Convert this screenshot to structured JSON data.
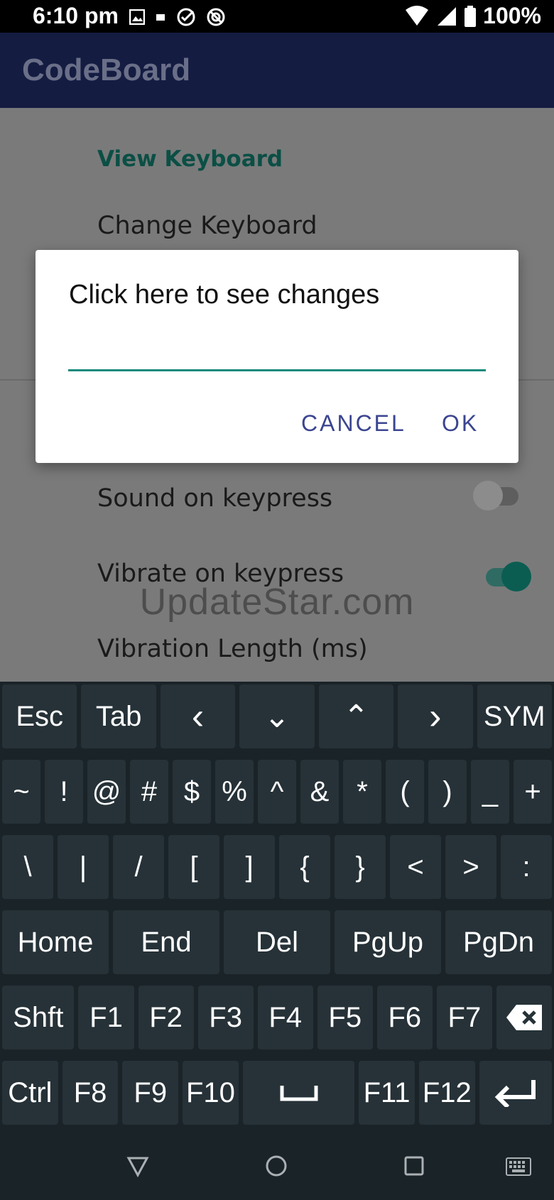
{
  "status_bar": {
    "time": "6:10 pm",
    "battery": "100%",
    "icons_left": [
      "image-icon",
      "notification-icon",
      "check-circle-icon",
      "blocked-icon"
    ],
    "icons_right": [
      "wifi-icon",
      "signal-icon",
      "battery-icon"
    ]
  },
  "app_bar": {
    "title": "CodeBoard"
  },
  "preferences": {
    "category": "View Keyboard",
    "change_keyboard": "Change Keyboard",
    "sound_on_keypress": "Sound on keypress",
    "vibrate_on_keypress": "Vibrate on keypress",
    "vibration_length": "Vibration Length (ms)",
    "sound_enabled": false,
    "vibrate_enabled": true
  },
  "watermark": "UpdateStar.com",
  "dialog": {
    "title": "Click here to see changes",
    "input_value": "",
    "cancel_label": "CANCEL",
    "ok_label": "OK"
  },
  "keyboard": {
    "rows": [
      [
        "Esc",
        "Tab",
        "‹",
        "⌄",
        "⌃",
        "›",
        "SYM"
      ],
      [
        "~",
        "!",
        "@",
        "#",
        "$",
        "%",
        "^",
        "&",
        "*",
        "(",
        ")",
        "_",
        "+"
      ],
      [
        "\\",
        "|",
        "/",
        "[",
        "]",
        "{",
        "}",
        "<",
        ">",
        ":"
      ],
      [
        "Home",
        "End",
        "Del",
        "PgUp",
        "PgDn"
      ],
      [
        "Shft",
        "F1",
        "F2",
        "F3",
        "F4",
        "F5",
        "F6",
        "F7",
        "⌫"
      ],
      [
        "Ctrl",
        "F8",
        "F9",
        "F10",
        "␣",
        "F11",
        "F12",
        "↵"
      ]
    ]
  },
  "colors": {
    "accent": "#138a7c",
    "app_bar": "#141c42",
    "dialog_button": "#3b4590",
    "keyboard_bg": "#1a2328",
    "key_bg": "#263238"
  }
}
